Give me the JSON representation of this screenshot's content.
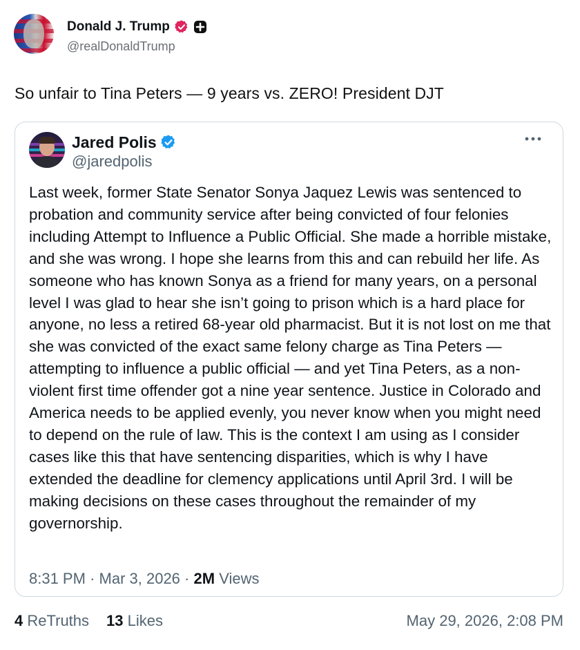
{
  "post": {
    "author": {
      "display_name": "Donald J. Trump",
      "handle": "@realDonaldTrump",
      "avatar_icon": "flag-portrait-avatar",
      "verified_icon": "verified-badge-icon",
      "verified_color": "#e0245e",
      "plus_icon": "plus-badge-icon"
    },
    "text": "So unfair to Tina Peters — 9 years vs. ZERO! President DJT"
  },
  "quoted_post": {
    "author": {
      "display_name": "Jared Polis",
      "handle": "@jaredpolis",
      "avatar_icon": "jared-polis-avatar",
      "verified_icon": "verified-badge-icon",
      "verified_color": "#1d9bf0"
    },
    "more_icon": "more-options-icon",
    "body": "Last week, former State Senator Sonya Jaquez Lewis was sentenced to probation and community service after being convicted of four felonies including Attempt to Influence a Public Official. She made a horrible mistake, and she was wrong. I hope she learns from this and can rebuild her life. As someone who has known Sonya as a friend for many years, on a personal level I was glad to hear she isn’t going to prison which is a hard place for anyone, no less a retired 68-year old pharmacist. But it is not lost on me that she was convicted of the exact same felony charge as Tina Peters — attempting to influence a public official — and yet Tina Peters, as a non-violent first time offender got a nine year sentence. Justice in Colorado and America needs to be applied evenly, you never know when you might need to depend on the rule of law. This is the context I am using as I consider cases like this that have sentencing disparities, which is why I have extended the deadline for clemency applications until April 3rd. I will be making decisions on these cases throughout the remainder of my governorship.",
    "time": "8:31 PM",
    "date": "Mar 3, 2026",
    "separator": "·",
    "views_count": "2M",
    "views_label": "Views"
  },
  "footer": {
    "retruths_count": "4",
    "retruths_label": "ReTruths",
    "likes_count": "13",
    "likes_label": "Likes",
    "timestamp": "May 29, 2026, 2:08 PM"
  }
}
